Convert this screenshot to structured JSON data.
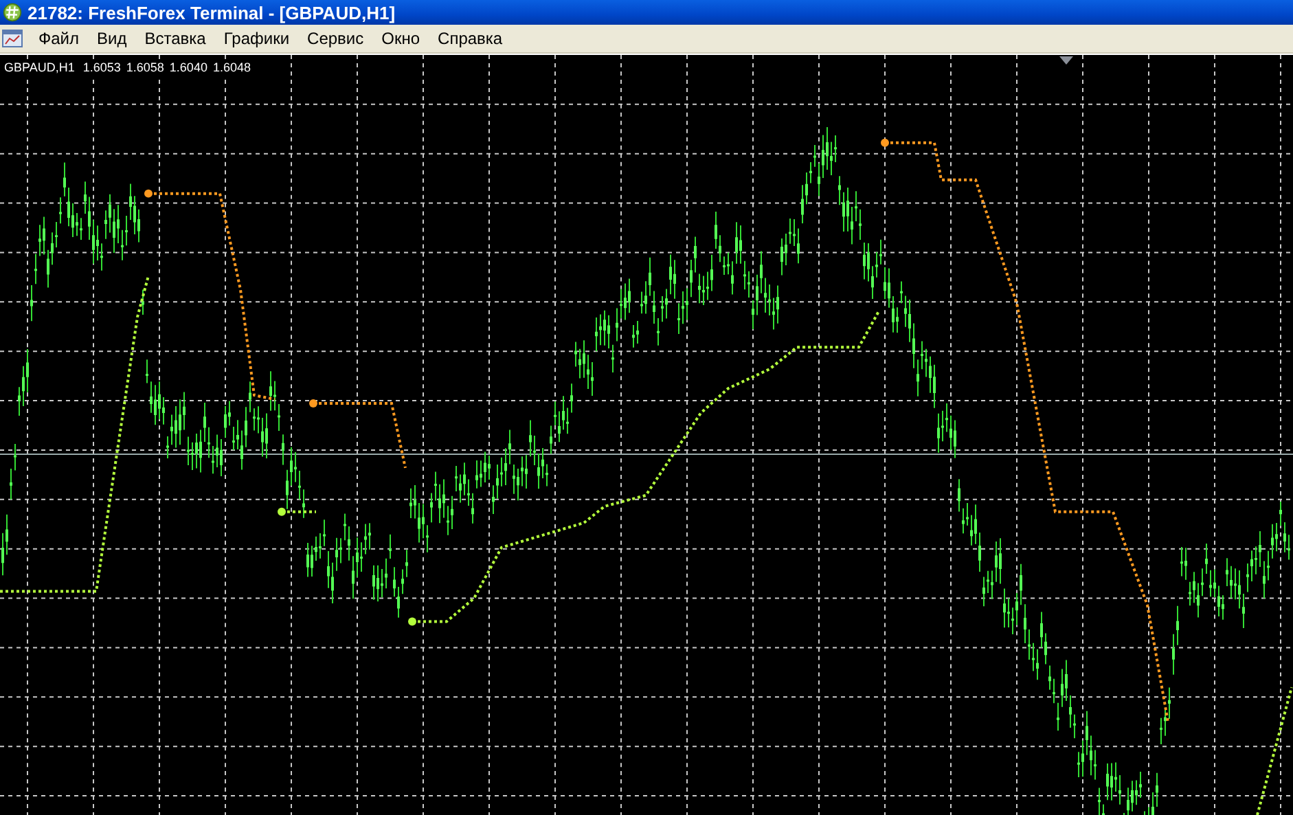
{
  "window": {
    "title": "21782: FreshForex Terminal - [GBPAUD,H1]"
  },
  "menu": [
    "Файл",
    "Вид",
    "Вставка",
    "Графики",
    "Сервис",
    "Окно",
    "Справка"
  ],
  "chart": {
    "symbol": "GBPAUD,H1",
    "quotes": [
      "1.6053",
      "1.6058",
      "1.6040",
      "1.6048"
    ]
  }
}
